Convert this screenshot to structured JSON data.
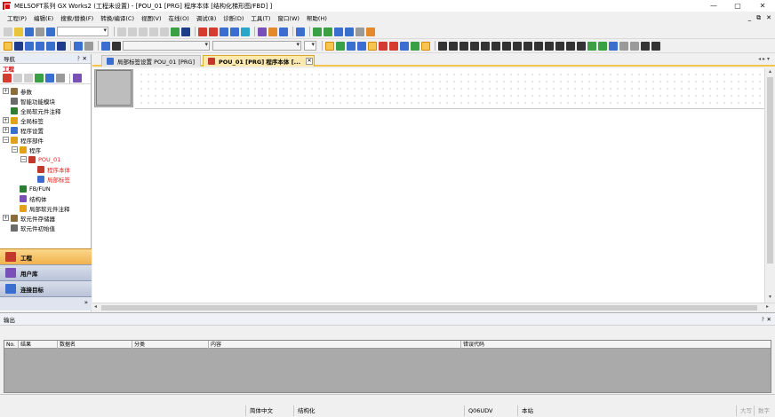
{
  "window": {
    "title": "MELSOFT系列 GX Works2 (工程未设置) - [POU_01 [PRG] 程序本体 [结构化梯形图/FBD] ]",
    "controls": [
      "—",
      "▢",
      "✕"
    ]
  },
  "menu": {
    "items": [
      "工程(P)",
      "编辑(E)",
      "搜索/替换(F)",
      "转换/编译(C)",
      "视图(V)",
      "在线(O)",
      "调试(B)",
      "诊断(D)",
      "工具(T)",
      "窗口(W)",
      "帮助(H)"
    ],
    "mdi_controls": [
      "_",
      "⧉",
      "✕"
    ]
  },
  "navigation": {
    "title": "导航",
    "pin_controls": "ᚹ ✕",
    "section_label": "工程",
    "tree": [
      {
        "label": "参数",
        "level": 0,
        "expander": "+",
        "icon_color": "#8a6d3b"
      },
      {
        "label": "智能功能模块",
        "level": 0,
        "expander": "",
        "icon_color": "#6b6b6b"
      },
      {
        "label": "全局软元件注释",
        "level": 0,
        "expander": "",
        "icon_color": "#2f7d32"
      },
      {
        "label": "全局标签",
        "level": 0,
        "expander": "+",
        "icon_color": "#e0a21b"
      },
      {
        "label": "程序设置",
        "level": 0,
        "expander": "+",
        "icon_color": "#3a6fd0"
      },
      {
        "label": "程序部件",
        "level": 0,
        "expander": "−",
        "icon_color": "#e0a21b"
      },
      {
        "label": "程序",
        "level": 1,
        "expander": "−",
        "icon_color": "#e0a21b"
      },
      {
        "label": "POU_01",
        "level": 2,
        "expander": "−",
        "icon_color": "#c0392b",
        "red": true
      },
      {
        "label": "程序本体",
        "level": 3,
        "expander": "",
        "icon_color": "#c0392b",
        "red": true
      },
      {
        "label": "局部标签",
        "level": 3,
        "expander": "",
        "icon_color": "#3a6fd0",
        "red": true
      },
      {
        "label": "FB/FUN",
        "level": 1,
        "expander": "",
        "icon_color": "#2f7d32"
      },
      {
        "label": "结构体",
        "level": 1,
        "expander": "",
        "icon_color": "#7a4fb8"
      },
      {
        "label": "局部软元件注释",
        "level": 1,
        "expander": "",
        "icon_color": "#e0a21b"
      },
      {
        "label": "软元件存储器",
        "level": 0,
        "expander": "+",
        "icon_color": "#8a6d3b"
      },
      {
        "label": "软元件初始值",
        "level": 0,
        "expander": "",
        "icon_color": "#6b6b6b"
      }
    ],
    "panels": [
      {
        "label": "工程",
        "active": true,
        "icon_color": "#c0392b"
      },
      {
        "label": "用户库",
        "active": false,
        "icon_color": "#7a4fb8"
      },
      {
        "label": "连接目标",
        "active": false,
        "icon_color": "#3a6fd0"
      }
    ],
    "footer_glyph": "»"
  },
  "tabs": {
    "items": [
      {
        "label": "局部标签设置 POU_01 [PRG]",
        "active": false
      },
      {
        "label": "POU_01 [PRG] 程序本体 [...",
        "active": true,
        "close": "✕"
      }
    ],
    "scroll": "◂ ▸ ▾"
  },
  "output": {
    "title": "输出",
    "pin_controls": "ᚹ ✕",
    "columns": [
      "No.",
      "结果",
      "数据名",
      "分类",
      "内容",
      "错误代码"
    ]
  },
  "status": {
    "cells": [
      {
        "label": "简体中文",
        "dim": false
      },
      {
        "label": "结构化",
        "dim": false
      },
      {
        "label": "Q06UDV",
        "dim": false
      },
      {
        "label": "本站",
        "dim": false
      },
      {
        "label": "大写",
        "dim": true
      },
      {
        "label": "数字",
        "dim": true
      }
    ]
  }
}
